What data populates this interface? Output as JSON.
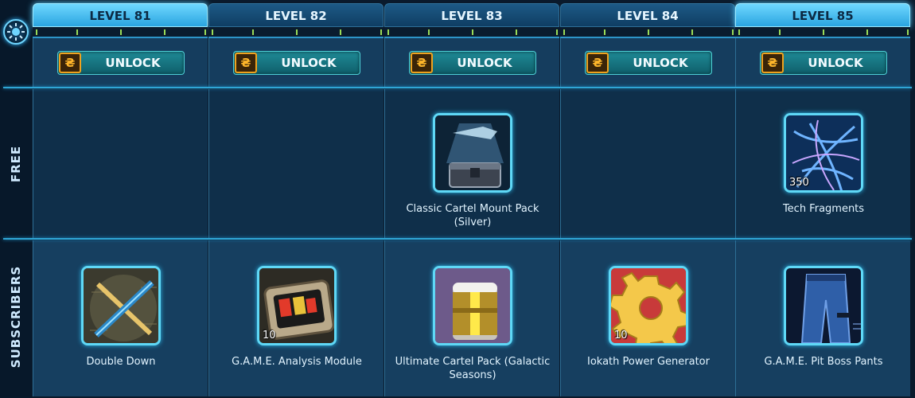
{
  "rows": {
    "free_label": "FREE",
    "subscribers_label": "SUBSCRIBERS"
  },
  "levels": [
    {
      "label": "LEVEL 81",
      "active": true,
      "unlock_label": "UNLOCK",
      "free": null,
      "subscriber": {
        "name": "Double Down",
        "qty": "",
        "icon": "double-down-weapon-icon"
      }
    },
    {
      "label": "LEVEL 82",
      "active": false,
      "unlock_label": "UNLOCK",
      "free": null,
      "subscriber": {
        "name": "G.A.M.E. Analysis Module",
        "qty": "10",
        "icon": "analysis-module-icon"
      }
    },
    {
      "label": "LEVEL 83",
      "active": false,
      "unlock_label": "UNLOCK",
      "free": {
        "name": "Classic Cartel Mount Pack (Silver)",
        "qty": "",
        "icon": "mount-pack-icon"
      },
      "subscriber": {
        "name": "Ultimate Cartel Pack (Galactic Seasons)",
        "qty": "",
        "icon": "cartel-pack-icon"
      }
    },
    {
      "label": "LEVEL 84",
      "active": false,
      "unlock_label": "UNLOCK",
      "free": null,
      "subscriber": {
        "name": "Iokath Power Generator",
        "qty": "10",
        "icon": "power-generator-icon"
      }
    },
    {
      "label": "LEVEL 85",
      "active": true,
      "unlock_label": "UNLOCK",
      "free": {
        "name": "Tech Fragments",
        "qty": "350",
        "icon": "tech-fragments-icon"
      },
      "subscriber": {
        "name": "G.A.M.E. Pit Boss Pants",
        "qty": "",
        "icon": "pants-icon"
      }
    }
  ],
  "colors": {
    "accent": "#5fd8f6",
    "unlock_button": "#1f8a96",
    "currency_orange": "#f0a21e",
    "tick_green": "#9bdc58"
  }
}
